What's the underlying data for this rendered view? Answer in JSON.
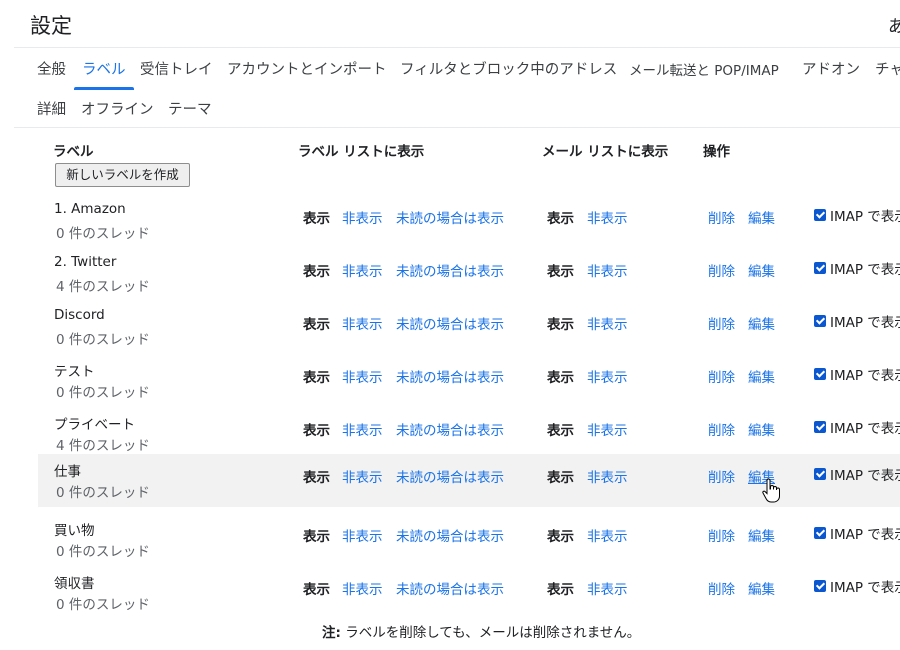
{
  "page": {
    "title": "設定",
    "title_right": "あ"
  },
  "tabs": [
    {
      "label": "全般"
    },
    {
      "label": "ラベル",
      "active": true
    },
    {
      "label": "受信トレイ"
    },
    {
      "label": "アカウントとインポート"
    },
    {
      "label": "フィルタとブロック中のアドレス"
    },
    {
      "label": "メール転送と POP/IMAP"
    },
    {
      "label": "アドオン"
    },
    {
      "label": "チャ"
    },
    {
      "label": "詳細"
    },
    {
      "label": "オフライン"
    },
    {
      "label": "テーマ"
    }
  ],
  "headers": {
    "label": "ラベル",
    "label_list": "ラベル リストに表示",
    "mail_list": "メール リストに表示",
    "actions": "操作"
  },
  "new_label_button": "新しいラベルを作成",
  "row_texts": {
    "show": "表示",
    "hide": "非表示",
    "show_if_unread": "未読の場合は表示",
    "delete": "削除",
    "edit": "編集",
    "imap": "IMAP で表示"
  },
  "labels": [
    {
      "name": "1. Amazon",
      "count": "0 件のスレッド"
    },
    {
      "name": "2. Twitter",
      "count": "4 件のスレッド"
    },
    {
      "name": "Discord",
      "count": "0 件のスレッド"
    },
    {
      "name": "テスト",
      "count": "0 件のスレッド"
    },
    {
      "name": "プライベート",
      "count": "4 件のスレッド"
    },
    {
      "name": "仕事",
      "count": "0 件のスレッド",
      "hovered": true
    },
    {
      "name": "買い物",
      "count": "0 件のスレッド"
    },
    {
      "name": "領収書",
      "count": "0 件のスレッド"
    }
  ],
  "note": {
    "prefix": "注:",
    "text": " ラベルを削除しても、メールは削除されません。"
  },
  "colors": {
    "link": "#1a73e8",
    "active_tab": "#1a73e8",
    "hover_row": "#f2f2f2",
    "checkbox": "#0b57d0"
  }
}
